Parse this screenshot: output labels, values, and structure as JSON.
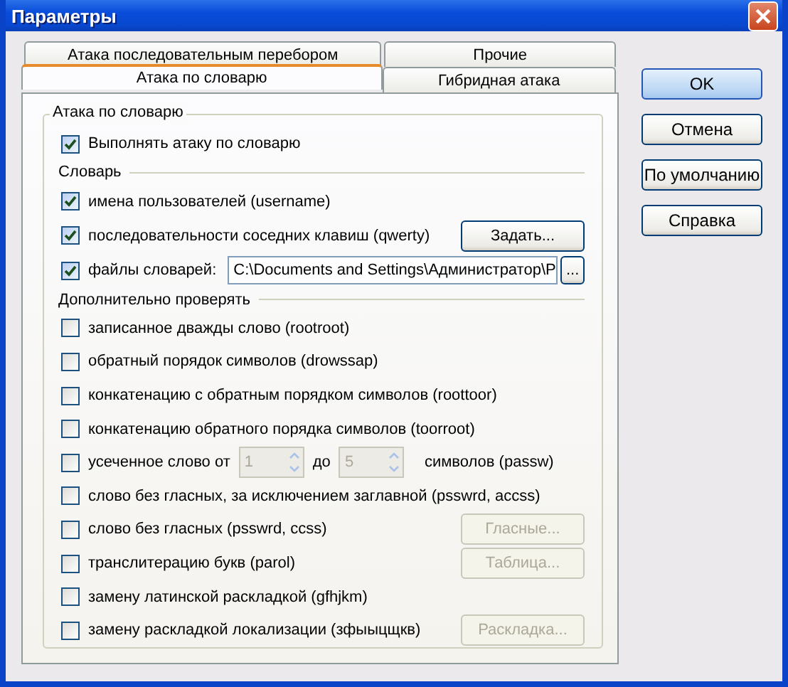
{
  "window": {
    "title": "Параметры"
  },
  "tab_rows": [
    {
      "tabs": [
        {
          "label": "Атака последовательным перебором",
          "selected": false
        },
        {
          "label": "Прочие",
          "selected": false
        }
      ]
    },
    {
      "tabs": [
        {
          "label": "Атака по словарю",
          "selected": true
        },
        {
          "label": "Гибридная атака",
          "selected": false
        }
      ]
    }
  ],
  "group": {
    "title": "Атака по словарю",
    "main_option": {
      "label": "Выполнять атаку по словарю",
      "checked": true
    }
  },
  "sections": [
    {
      "title": "Словарь",
      "items": [
        {
          "kind": "check",
          "label": "имена пользователей (username)",
          "checked": true
        },
        {
          "kind": "check_button",
          "label": "последовательности соседних клавиш (qwerty)",
          "checked": true,
          "button": {
            "label": "Задать...",
            "disabled": false
          }
        },
        {
          "kind": "check_path",
          "label": "файлы словарей:",
          "checked": true,
          "value": "C:\\Documents and Settings\\Администратор\\P",
          "browse": "..."
        }
      ]
    },
    {
      "title": "Дополнительно проверять",
      "items": [
        {
          "kind": "check",
          "label": "записанное дважды слово (rootroot)",
          "checked": false
        },
        {
          "kind": "check",
          "label": "обратный порядок символов (drowssap)",
          "checked": false
        },
        {
          "kind": "check",
          "label": "конкатенацию с обратным порядком символов (roottoor)",
          "checked": false
        },
        {
          "kind": "check",
          "label": "конкатенацию обратного порядка символов (toorroot)",
          "checked": false
        },
        {
          "kind": "range",
          "label": "усеченное слово от",
          "checked": false,
          "from": "1",
          "to_label": "до",
          "to": "5",
          "suffix": "символов (passw)",
          "disabled": true
        },
        {
          "kind": "check",
          "label": "слово без гласных, за исключением заглавной (psswrd, accss)",
          "checked": false
        },
        {
          "kind": "check_button",
          "label": "слово без гласных (psswrd, ccss)",
          "checked": false,
          "button": {
            "label": "Гласные...",
            "disabled": true
          }
        },
        {
          "kind": "check_button",
          "label": "транслитерацию букв (parol)",
          "checked": false,
          "button": {
            "label": "Таблица...",
            "disabled": true
          }
        },
        {
          "kind": "check",
          "label": "замену латинской раскладкой (gfhjkm)",
          "checked": false
        },
        {
          "kind": "check_button",
          "label": "замену раскладкой локализации (зфыыцщкв)",
          "checked": false,
          "button": {
            "label": "Раскладка...",
            "disabled": true
          }
        }
      ]
    }
  ],
  "buttons": [
    {
      "label": "OK",
      "default": true
    },
    {
      "label": "Отмена",
      "default": false
    },
    {
      "label": "По умолчанию",
      "default": false
    },
    {
      "label": "Справка",
      "default": false
    }
  ]
}
